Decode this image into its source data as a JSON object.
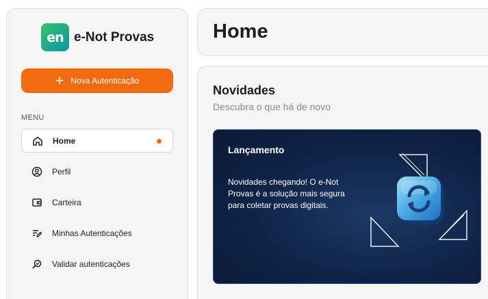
{
  "sidebar": {
    "logo_text": "en",
    "brand_name": "e-Not Provas",
    "new_button_label": "Nova Autenticação",
    "menu_label": "MENU",
    "items": [
      {
        "label": "Home",
        "icon": "home-icon",
        "active": true
      },
      {
        "label": "Perfil",
        "icon": "user-icon"
      },
      {
        "label": "Carteira",
        "icon": "wallet-icon"
      },
      {
        "label": "Minhas Autenticações",
        "icon": "edit-list-icon"
      },
      {
        "label": "Validar autenticações",
        "icon": "search-check-icon"
      }
    ]
  },
  "header": {
    "title": "Home"
  },
  "main": {
    "section_title": "Novidades",
    "section_subtitle": "Descubra o que há de novo",
    "card": {
      "title": "Lançamento",
      "text": "Novidades chegando! O e-Not Provas é a solução mais segura para coletar provas digitais.",
      "art_icon": "sync-icon"
    }
  },
  "colors": {
    "accent": "#f26b0f",
    "card_bg": "#0f2346",
    "panel_bg": "#f5f5f5"
  }
}
